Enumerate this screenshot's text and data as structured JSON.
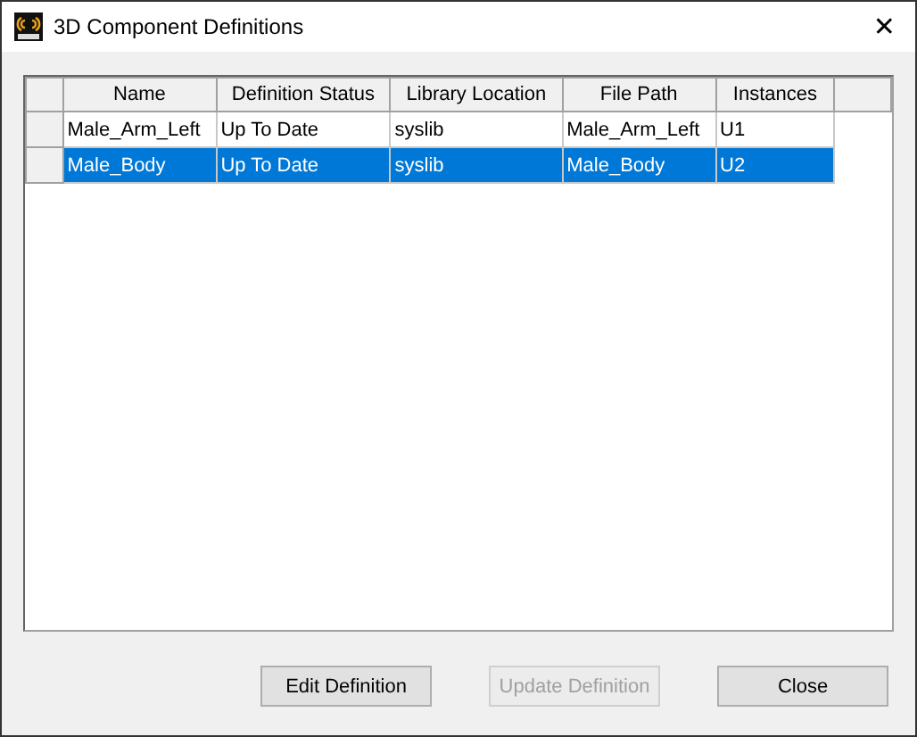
{
  "window": {
    "title": "3D Component Definitions",
    "close": "✕"
  },
  "table": {
    "columns": [
      "Name",
      "Definition Status",
      "Library Location",
      "File Path",
      "Instances"
    ],
    "rows": [
      {
        "cells": [
          "Male_Arm_Left",
          "Up To Date",
          "syslib",
          "Male_Arm_Left",
          "U1"
        ],
        "selected": false
      },
      {
        "cells": [
          "Male_Body",
          "Up To Date",
          "syslib",
          "Male_Body",
          "U2"
        ],
        "selected": true
      }
    ]
  },
  "buttons": [
    {
      "label": "Edit Definition",
      "disabled": false
    },
    {
      "label": "Update Definition",
      "disabled": true
    },
    {
      "label": "Close",
      "disabled": false
    }
  ]
}
